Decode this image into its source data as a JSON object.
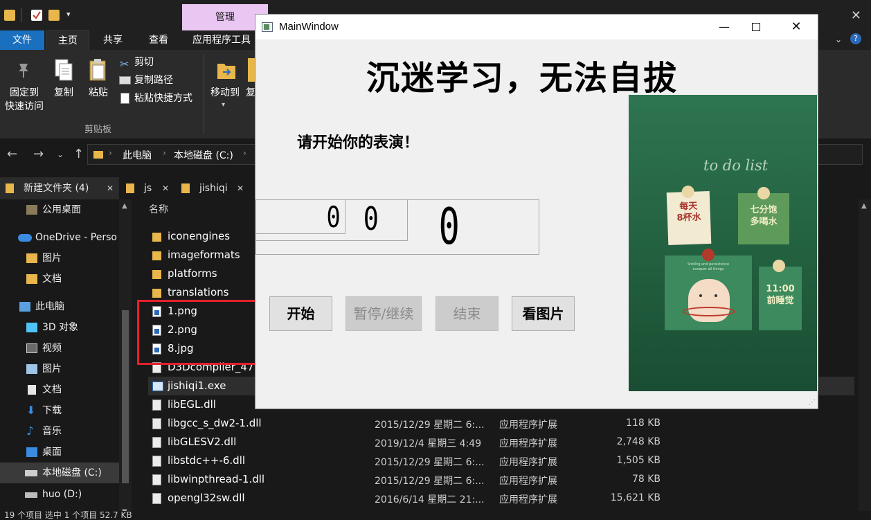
{
  "explorer": {
    "manage_tab": "管理",
    "ribbon_tabs": [
      "文件",
      "主页",
      "共享",
      "查看",
      "应用程序工具"
    ],
    "ribbon": {
      "pin_label_1": "固定到",
      "pin_label_2": "快速访问",
      "copy_label": "复制",
      "paste_label": "粘贴",
      "cut_label": "剪切",
      "copy_path_label": "复制路径",
      "paste_shortcut_label": "粘贴快捷方式",
      "clipboard_group": "剪贴板",
      "move_to_label": "移动到",
      "copy_to_partial": "复"
    },
    "breadcrumb": [
      "此电脑",
      "本地磁盘 (C:)"
    ],
    "tabs": [
      "新建文件夹 (4)",
      "js",
      "jishiqi"
    ],
    "nav_items": [
      "公用桌面",
      "OneDrive - Perso",
      "图片",
      "文档",
      "此电脑",
      "3D 对象",
      "视频",
      "图片",
      "文档",
      "下载",
      "音乐",
      "桌面",
      "本地磁盘 (C:)",
      "huo (D:)"
    ],
    "column_name": "名称",
    "files": [
      {
        "name": "iconengines",
        "date": "",
        "type": "",
        "size": ""
      },
      {
        "name": "imageformats",
        "date": "",
        "type": "",
        "size": ""
      },
      {
        "name": "platforms",
        "date": "",
        "type": "",
        "size": ""
      },
      {
        "name": "translations",
        "date": "",
        "type": "",
        "size": ""
      },
      {
        "name": "1.png",
        "date": "",
        "type": "",
        "size": ""
      },
      {
        "name": "2.png",
        "date": "",
        "type": "",
        "size": ""
      },
      {
        "name": "8.jpg",
        "date": "",
        "type": "",
        "size": ""
      },
      {
        "name": "D3Dcompiler_47.",
        "date": "",
        "type": "",
        "size": ""
      },
      {
        "name": "jishiqi1.exe",
        "date": "",
        "type": "",
        "size": ""
      },
      {
        "name": "libEGL.dll",
        "date": "",
        "type": "",
        "size": ""
      },
      {
        "name": "libgcc_s_dw2-1.dll",
        "date": "2015/12/29 星期二 6:...",
        "type": "应用程序扩展",
        "size": "118 KB"
      },
      {
        "name": "libGLESV2.dll",
        "date": "2019/12/4 星期三 4:49",
        "type": "应用程序扩展",
        "size": "2,748 KB"
      },
      {
        "name": "libstdc++-6.dll",
        "date": "2015/12/29 星期二 6:...",
        "type": "应用程序扩展",
        "size": "1,505 KB"
      },
      {
        "name": "libwinpthread-1.dll",
        "date": "2015/12/29 星期二 6:...",
        "type": "应用程序扩展",
        "size": "78 KB"
      },
      {
        "name": "opengl32sw.dll",
        "date": "2016/6/14 星期二 21:...",
        "type": "应用程序扩展",
        "size": "15,621 KB"
      }
    ],
    "status_text": "19 个项目  选中 1 个项目 52.7 KB"
  },
  "mainwindow": {
    "title": "MainWindow",
    "heading": "沉迷学习，无法自拔",
    "prompt": "请开始你的表演！",
    "lcd_small_1": "0",
    "lcd_small_2": "0",
    "lcd_large": "0",
    "buttons": {
      "start": "开始",
      "pause_resume": "暂停/继续",
      "stop": "结束",
      "view_image": "看图片"
    },
    "picture": {
      "header": "to do list",
      "note_1": "每天\n8杯水",
      "note_2": "七分饱\n多喝水",
      "note_3": "11:00\n前睡觉",
      "note_4": "Smiling and persistence\nconquer all things"
    }
  }
}
